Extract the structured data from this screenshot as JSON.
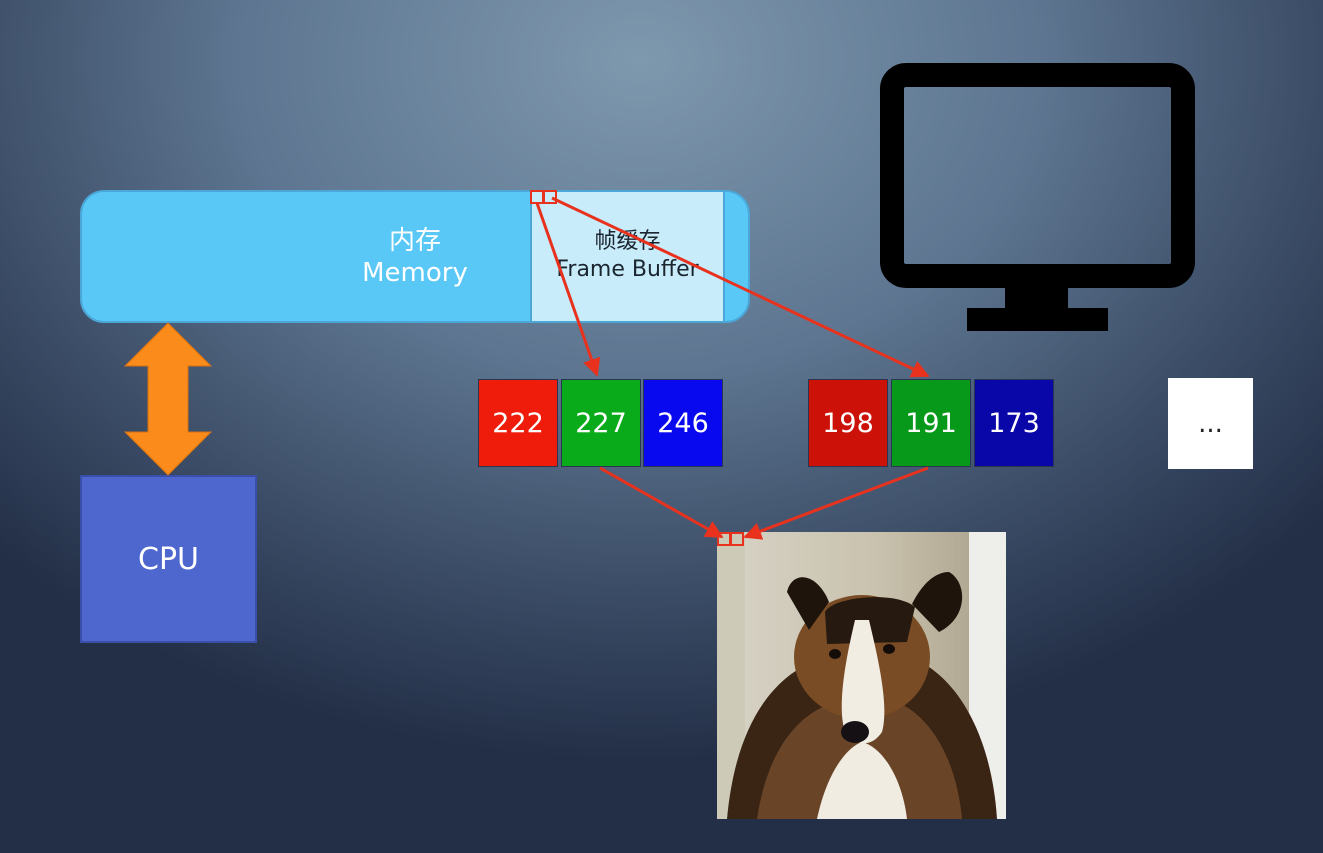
{
  "memory": {
    "zh": "内存",
    "en": "Memory"
  },
  "frame_buffer": {
    "zh": "帧缓存",
    "en": "Frame Buffer"
  },
  "cpu": {
    "label": "CPU"
  },
  "pixel_a": {
    "r": "222",
    "g": "227",
    "b": "246"
  },
  "pixel_b": {
    "r": "198",
    "g": "191",
    "b": "173"
  },
  "more": {
    "label": "..."
  },
  "colors": {
    "memory_fill": "#5ac8f6",
    "frame_buffer_fill": "#c8ecfa",
    "cpu_fill": "#4e67cf",
    "arrow_red": "#e8321e",
    "bus_arrow": "#fb8c1c",
    "red_channel": "#ef1c0c",
    "green_channel": "#0aab1b",
    "blue_channel": "#0909f0",
    "red_channel_dark": "#cc1208",
    "green_channel_dark": "#07991a",
    "blue_channel_dark": "#0a07a8"
  }
}
